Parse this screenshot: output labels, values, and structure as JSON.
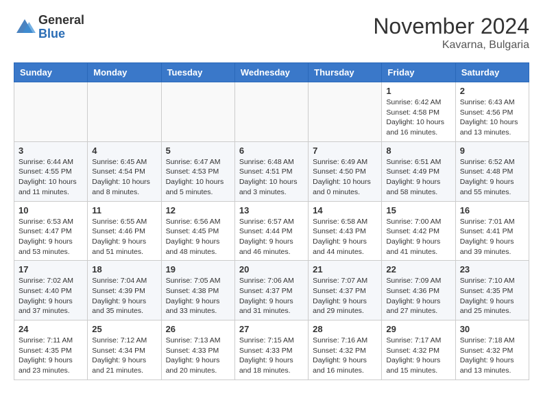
{
  "header": {
    "logo": {
      "general": "General",
      "blue": "Blue"
    },
    "title": "November 2024",
    "location": "Kavarna, Bulgaria"
  },
  "calendar": {
    "days_of_week": [
      "Sunday",
      "Monday",
      "Tuesday",
      "Wednesday",
      "Thursday",
      "Friday",
      "Saturday"
    ],
    "weeks": [
      [
        {
          "day": "",
          "info": ""
        },
        {
          "day": "",
          "info": ""
        },
        {
          "day": "",
          "info": ""
        },
        {
          "day": "",
          "info": ""
        },
        {
          "day": "",
          "info": ""
        },
        {
          "day": "1",
          "info": "Sunrise: 6:42 AM\nSunset: 4:58 PM\nDaylight: 10 hours\nand 16 minutes."
        },
        {
          "day": "2",
          "info": "Sunrise: 6:43 AM\nSunset: 4:56 PM\nDaylight: 10 hours\nand 13 minutes."
        }
      ],
      [
        {
          "day": "3",
          "info": "Sunrise: 6:44 AM\nSunset: 4:55 PM\nDaylight: 10 hours\nand 11 minutes."
        },
        {
          "day": "4",
          "info": "Sunrise: 6:45 AM\nSunset: 4:54 PM\nDaylight: 10 hours\nand 8 minutes."
        },
        {
          "day": "5",
          "info": "Sunrise: 6:47 AM\nSunset: 4:53 PM\nDaylight: 10 hours\nand 5 minutes."
        },
        {
          "day": "6",
          "info": "Sunrise: 6:48 AM\nSunset: 4:51 PM\nDaylight: 10 hours\nand 3 minutes."
        },
        {
          "day": "7",
          "info": "Sunrise: 6:49 AM\nSunset: 4:50 PM\nDaylight: 10 hours\nand 0 minutes."
        },
        {
          "day": "8",
          "info": "Sunrise: 6:51 AM\nSunset: 4:49 PM\nDaylight: 9 hours\nand 58 minutes."
        },
        {
          "day": "9",
          "info": "Sunrise: 6:52 AM\nSunset: 4:48 PM\nDaylight: 9 hours\nand 55 minutes."
        }
      ],
      [
        {
          "day": "10",
          "info": "Sunrise: 6:53 AM\nSunset: 4:47 PM\nDaylight: 9 hours\nand 53 minutes."
        },
        {
          "day": "11",
          "info": "Sunrise: 6:55 AM\nSunset: 4:46 PM\nDaylight: 9 hours\nand 51 minutes."
        },
        {
          "day": "12",
          "info": "Sunrise: 6:56 AM\nSunset: 4:45 PM\nDaylight: 9 hours\nand 48 minutes."
        },
        {
          "day": "13",
          "info": "Sunrise: 6:57 AM\nSunset: 4:44 PM\nDaylight: 9 hours\nand 46 minutes."
        },
        {
          "day": "14",
          "info": "Sunrise: 6:58 AM\nSunset: 4:43 PM\nDaylight: 9 hours\nand 44 minutes."
        },
        {
          "day": "15",
          "info": "Sunrise: 7:00 AM\nSunset: 4:42 PM\nDaylight: 9 hours\nand 41 minutes."
        },
        {
          "day": "16",
          "info": "Sunrise: 7:01 AM\nSunset: 4:41 PM\nDaylight: 9 hours\nand 39 minutes."
        }
      ],
      [
        {
          "day": "17",
          "info": "Sunrise: 7:02 AM\nSunset: 4:40 PM\nDaylight: 9 hours\nand 37 minutes."
        },
        {
          "day": "18",
          "info": "Sunrise: 7:04 AM\nSunset: 4:39 PM\nDaylight: 9 hours\nand 35 minutes."
        },
        {
          "day": "19",
          "info": "Sunrise: 7:05 AM\nSunset: 4:38 PM\nDaylight: 9 hours\nand 33 minutes."
        },
        {
          "day": "20",
          "info": "Sunrise: 7:06 AM\nSunset: 4:37 PM\nDaylight: 9 hours\nand 31 minutes."
        },
        {
          "day": "21",
          "info": "Sunrise: 7:07 AM\nSunset: 4:37 PM\nDaylight: 9 hours\nand 29 minutes."
        },
        {
          "day": "22",
          "info": "Sunrise: 7:09 AM\nSunset: 4:36 PM\nDaylight: 9 hours\nand 27 minutes."
        },
        {
          "day": "23",
          "info": "Sunrise: 7:10 AM\nSunset: 4:35 PM\nDaylight: 9 hours\nand 25 minutes."
        }
      ],
      [
        {
          "day": "24",
          "info": "Sunrise: 7:11 AM\nSunset: 4:35 PM\nDaylight: 9 hours\nand 23 minutes."
        },
        {
          "day": "25",
          "info": "Sunrise: 7:12 AM\nSunset: 4:34 PM\nDaylight: 9 hours\nand 21 minutes."
        },
        {
          "day": "26",
          "info": "Sunrise: 7:13 AM\nSunset: 4:33 PM\nDaylight: 9 hours\nand 20 minutes."
        },
        {
          "day": "27",
          "info": "Sunrise: 7:15 AM\nSunset: 4:33 PM\nDaylight: 9 hours\nand 18 minutes."
        },
        {
          "day": "28",
          "info": "Sunrise: 7:16 AM\nSunset: 4:32 PM\nDaylight: 9 hours\nand 16 minutes."
        },
        {
          "day": "29",
          "info": "Sunrise: 7:17 AM\nSunset: 4:32 PM\nDaylight: 9 hours\nand 15 minutes."
        },
        {
          "day": "30",
          "info": "Sunrise: 7:18 AM\nSunset: 4:32 PM\nDaylight: 9 hours\nand 13 minutes."
        }
      ]
    ]
  }
}
